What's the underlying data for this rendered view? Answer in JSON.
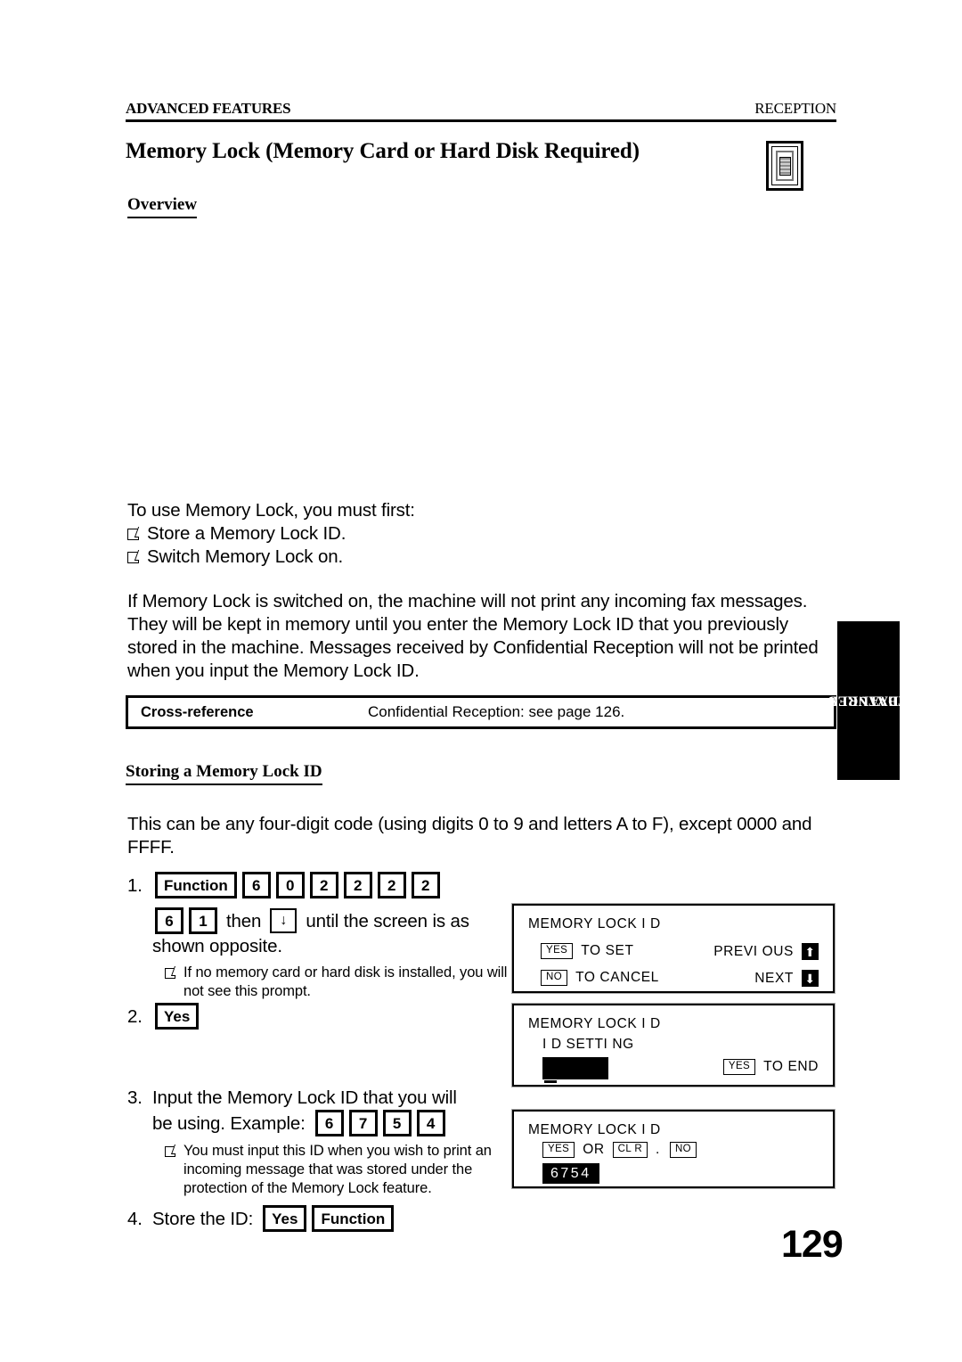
{
  "header": {
    "left": "ADVANCED FEATURES",
    "right": "RECEPTION"
  },
  "chapter_title": "Memory Lock (Memory Card or Hard Disk Required)",
  "side_tab": {
    "line1": "ADVANCED",
    "line2": "FEATURES"
  },
  "sections": {
    "overview_heading": "Overview",
    "storing_heading": "Storing a Memory Lock ID"
  },
  "overview": {
    "intro": "To use Memory Lock, you must first:",
    "bullets": [
      "Store a Memory Lock ID.",
      "Switch Memory Lock on."
    ],
    "paragraph": "If Memory Lock is switched on, the machine will not print any incoming fax messages. They will be kept in memory until you enter the Memory Lock ID that you previously stored in the machine. Messages received by Confidential Reception will not be printed when you input the Memory Lock ID."
  },
  "cross_reference": {
    "label": "Cross-reference",
    "value": "Confidential Reception: see page 126."
  },
  "storing": {
    "intro": "This can be any four-digit code (using digits 0 to 9 and letters A to F), except 0000 and FFFF.",
    "step1": {
      "num": "1.",
      "keys": [
        "Function",
        "6",
        "0",
        "2",
        "2",
        "2",
        "2"
      ],
      "keys_line2": [
        "6",
        "1"
      ],
      "then_label": "then",
      "arrow_key": "↓",
      "after_arrow": "until the screen is as",
      "wrap": "shown opposite.",
      "note": "If no memory card or hard disk is installed, you will not see this prompt."
    },
    "step2": {
      "num": "2.",
      "key": "Yes"
    },
    "step3": {
      "num": "3.",
      "text_line1": "Input the Memory Lock ID that you will",
      "text_line2": "be using. Example:",
      "keys": [
        "6",
        "7",
        "5",
        "4"
      ],
      "note": "You must input this ID when you wish to print an incoming message that was stored under the protection of the Memory Lock feature."
    },
    "step4": {
      "num": "4.",
      "label": "Store the ID:",
      "keys": [
        "Yes",
        "Function"
      ]
    }
  },
  "lcd_panels": [
    {
      "title": "MEMORY LOCK I D",
      "rows": [
        {
          "key": "YES",
          "label": "TO SET",
          "right_label": "PREVI OUS",
          "arrow": "⬆"
        },
        {
          "key": "NO",
          "label": "TO CANCEL",
          "right_label": "NEXT",
          "arrow": "⬇"
        }
      ]
    },
    {
      "title": "MEMORY LOCK I D",
      "subtitle": "I D SETTI NG",
      "value": "",
      "right_key": "YES",
      "right_label": "TO END"
    },
    {
      "title": "MEMORY LOCK I D",
      "key1": "YES",
      "or_label": "OR",
      "key2": "CL R",
      "dot": ".",
      "key3": "NO",
      "value": "6754"
    }
  ],
  "page_number": "129"
}
